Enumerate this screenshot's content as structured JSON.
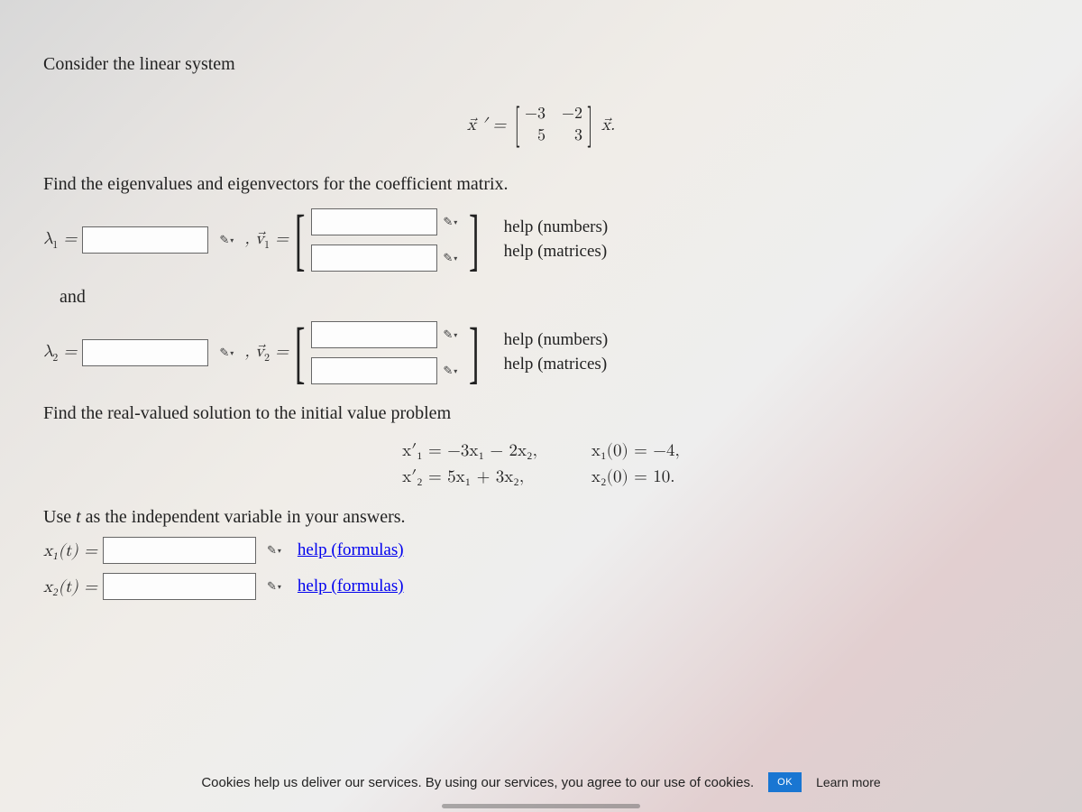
{
  "intro": "Consider the linear system",
  "system": {
    "lhs": "x⃗ ′ =",
    "matrix": [
      [
        "−3",
        "−2"
      ],
      [
        "5",
        "3"
      ]
    ],
    "rhs": "x⃗."
  },
  "task1": "Find the eigenvalues and eigenvectors for the coefficient matrix.",
  "eig": {
    "lambda1_label": "λ",
    "lambda1_sub": "1",
    "eq": " = ",
    "comma_v1": ", v⃗",
    "v1_sub": "1",
    "help_numbers": "help (numbers)",
    "help_matrices": "help (matrices)",
    "and": "and",
    "lambda2_sub": "2",
    "v2_sub": "2"
  },
  "task2": "Find the real-valued solution to the initial value problem",
  "ivp": {
    "eq1": "x′₁ = −3x₁ − 2x₂,",
    "eq2": "x′₂ = 5x₁ + 3x₂,",
    "ic1": "x₁(0) = −4,",
    "ic2": "x₂(0) = 10."
  },
  "task3": "Use t as the independent variable in your answers.",
  "sol": {
    "x1_label": "x₁(t) = ",
    "x2_label": "x₂(t) = ",
    "help_formulas": "help (formulas)"
  },
  "cookie": {
    "text": "Cookies help us deliver our services. By using our services, you agree to our use of cookies.",
    "ok": "OK",
    "learn": "Learn more"
  },
  "pencil_glyph": "✎",
  "tri_glyph": "▾"
}
